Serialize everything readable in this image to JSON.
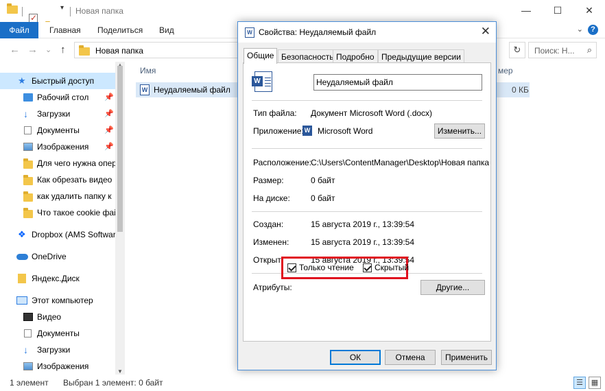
{
  "window": {
    "title": "Новая папка",
    "minimize": "—",
    "maximize": "☐",
    "close": "✕"
  },
  "ribbon": {
    "tabs": [
      "Файл",
      "Главная",
      "Поделиться",
      "Вид"
    ],
    "help": "?"
  },
  "address": {
    "back": "←",
    "forward": "→",
    "recent": "⌄",
    "up": "↑",
    "path": "Новая папка",
    "refresh": "↻",
    "search_placeholder": "Поиск: Н...",
    "search_icon": "⌕"
  },
  "nav": {
    "items": [
      {
        "label": "Быстрый доступ",
        "icon": "star-icon"
      },
      {
        "label": "Рабочий стол",
        "icon": "desktop-icon"
      },
      {
        "label": "Загрузки",
        "icon": "download-icon"
      },
      {
        "label": "Документы",
        "icon": "documents-icon"
      },
      {
        "label": "Изображения",
        "icon": "pictures-icon"
      },
      {
        "label": "Для чего нужна опер",
        "icon": "folder-icon"
      },
      {
        "label": "Как обрезать видео",
        "icon": "folder-icon"
      },
      {
        "label": "как удалить папку к",
        "icon": "folder-icon"
      },
      {
        "label": "Что такое cookie фай",
        "icon": "folder-icon"
      },
      {
        "label": "Dropbox (AMS Software)",
        "icon": "dropbox-icon"
      },
      {
        "label": "OneDrive",
        "icon": "onedrive-icon"
      },
      {
        "label": "Яндекс.Диск",
        "icon": "yandex-disk-icon"
      },
      {
        "label": "Этот компьютер",
        "icon": "computer-icon"
      },
      {
        "label": "Видео",
        "icon": "video-icon"
      },
      {
        "label": "Документы",
        "icon": "documents-icon"
      },
      {
        "label": "Загрузки",
        "icon": "download-icon"
      },
      {
        "label": "Изображения",
        "icon": "pictures-icon"
      }
    ]
  },
  "filelist": {
    "col_name": "Имя",
    "col_size": "мер",
    "files": [
      {
        "name": "Неудаляемый файл",
        "size": "0 КБ"
      }
    ]
  },
  "status": {
    "count": "1 элемент",
    "selected": "Выбран 1 элемент: 0 байт"
  },
  "dialog": {
    "title": "Свойства: Неудаляемый файл",
    "tabs": [
      "Общие",
      "Безопасность",
      "Подробно",
      "Предыдущие версии"
    ],
    "filename": "Неудаляемый файл",
    "file_type_label": "Тип файла:",
    "file_type_value": "Документ Microsoft Word (.docx)",
    "app_label": "Приложение:",
    "app_value": "Microsoft Word",
    "change_button": "Изменить...",
    "location_label": "Расположение:",
    "location_value": "C:\\Users\\ContentManager\\Desktop\\Новая папка",
    "size_label": "Размер:",
    "size_value": "0 байт",
    "ondisk_label": "На диске:",
    "ondisk_value": "0 байт",
    "created_label": "Создан:",
    "created_value": "15 августа 2019 г., 13:39:54",
    "modified_label": "Изменен:",
    "modified_value": "15 августа 2019 г., 13:39:54",
    "opened_label": "Открыт:",
    "opened_value": "15 августа 2019 г., 13:39:54",
    "attributes_label": "Атрибуты:",
    "readonly_label": "Только чтение",
    "readonly_checked": true,
    "hidden_label": "Скрытый",
    "hidden_checked": true,
    "other_button": "Другие...",
    "ok_button": "ОК",
    "cancel_button": "Отмена",
    "apply_button": "Применить"
  }
}
